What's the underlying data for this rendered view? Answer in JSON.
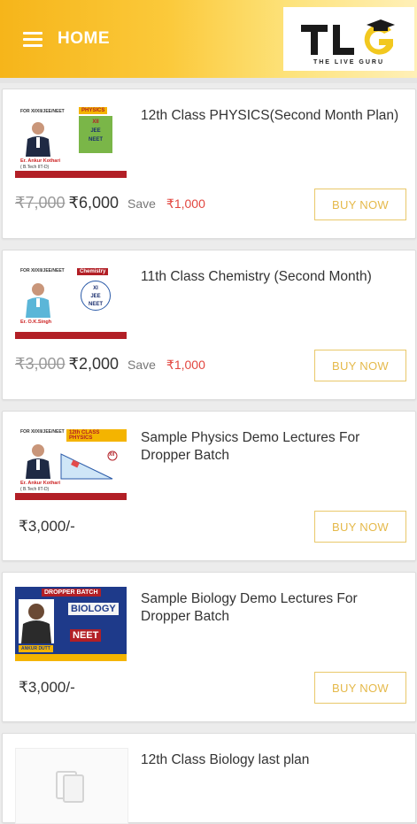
{
  "header": {
    "title": "HOME",
    "logo_text": "TLG",
    "logo_tagline": "THE LIVE GURU"
  },
  "courses": [
    {
      "title": "12th Class PHYSICS(Second Month Plan)",
      "old_price": "₹7,000",
      "new_price": "₹6,000",
      "save_label": "Save",
      "save_amount": "₹1,000",
      "button": "BUY NOW",
      "thumb": {
        "subject": "PHYSICS",
        "grade": "XII",
        "exams": [
          "JEE",
          "NEET"
        ],
        "teacher": "Er. Ankur Kothari",
        "teacher_sub": "( B.Tech IIT-D)"
      }
    },
    {
      "title": "11th Class Chemistry (Second Month)",
      "old_price": "₹3,000",
      "new_price": "₹2,000",
      "save_label": "Save",
      "save_amount": "₹1,000",
      "button": "BUY NOW",
      "thumb": {
        "subject": "Chemistry",
        "grade": "XI",
        "exams": [
          "JEE",
          "NEET"
        ],
        "teacher": "Er. O.K.Singh"
      }
    },
    {
      "title": "Sample Physics Demo Lectures For Dropper Batch",
      "price": "₹3,000/-",
      "button": "BUY NOW",
      "thumb": {
        "subject": "12th CLASS PHYSICS",
        "grade": "XII",
        "teacher": "Er. Ankur Kothari",
        "teacher_sub": "( B.Tech IIT-D)"
      }
    },
    {
      "title": "Sample Biology Demo Lectures For Dropper Batch",
      "price": "₹3,000/-",
      "button": "BUY NOW",
      "thumb": {
        "banner": "DROPPER BATCH",
        "subject": "BIOLOGY",
        "exam": "NEET",
        "teacher": "ANKUR DUTT"
      }
    },
    {
      "title": "12th Class Biology last plan"
    }
  ],
  "colors": {
    "accent": "#f6b51a",
    "button_border": "#e9c86a",
    "save_red": "#e2463f"
  }
}
